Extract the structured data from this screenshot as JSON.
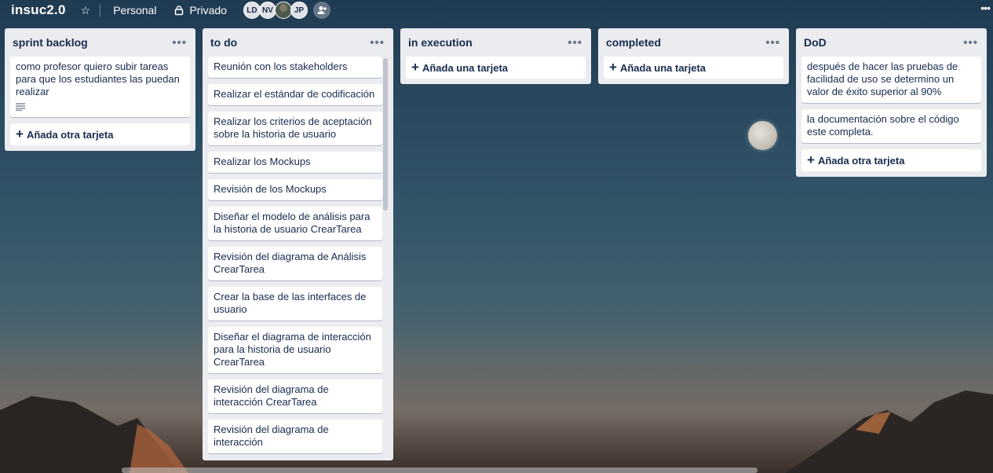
{
  "board": {
    "title": "insuc2.0",
    "team": "Personal",
    "privacy": "Privado"
  },
  "members": [
    "LD",
    "NV",
    "JP"
  ],
  "lists": [
    {
      "title": "sprint backlog",
      "cards": [
        "como profesor quiero subir tareas para que los estudiantes las puedan realizar"
      ],
      "add_label": "Añada otra tarjeta"
    },
    {
      "title": "to do",
      "cards": [
        "Reunión con los stakeholders",
        "Realizar el estándar de codificación",
        "Realizar los criterios de aceptación sobre la historia de usuario",
        "Realizar los Mockups",
        "Revisión de los Mockups",
        "Diseñar el modelo de análisis para la historia de usuario CrearTarea",
        "Revisión del diagrama de Análisis CrearTarea",
        "Crear la base de las interfaces de usuario",
        "Diseñar el diagrama de interacción para la historia de usuario CrearTarea",
        "Revisión del diagrama de interacción CrearTarea",
        "Revisión del diagrama de interacción"
      ]
    },
    {
      "title": "in execution",
      "cards": [],
      "add_label": "Añada una tarjeta"
    },
    {
      "title": "completed",
      "cards": [],
      "add_label": "Añada una tarjeta"
    },
    {
      "title": "DoD",
      "cards": [
        "después de hacer las pruebas de facilidad de uso se determino un valor de éxito superior al 90%",
        "la documentación sobre el código este completa."
      ],
      "add_label": "Añada otra tarjeta"
    }
  ],
  "icons": {
    "star": "star-icon",
    "lock": "lock-icon",
    "invite": "add-member-icon",
    "list_menu": "ellipsis-icon",
    "description": "description-icon",
    "board_menu": "ellipsis-icon"
  },
  "colors": {
    "list_bg": "#ebecf0",
    "card_bg": "#ffffff",
    "text": "#172b4d"
  }
}
